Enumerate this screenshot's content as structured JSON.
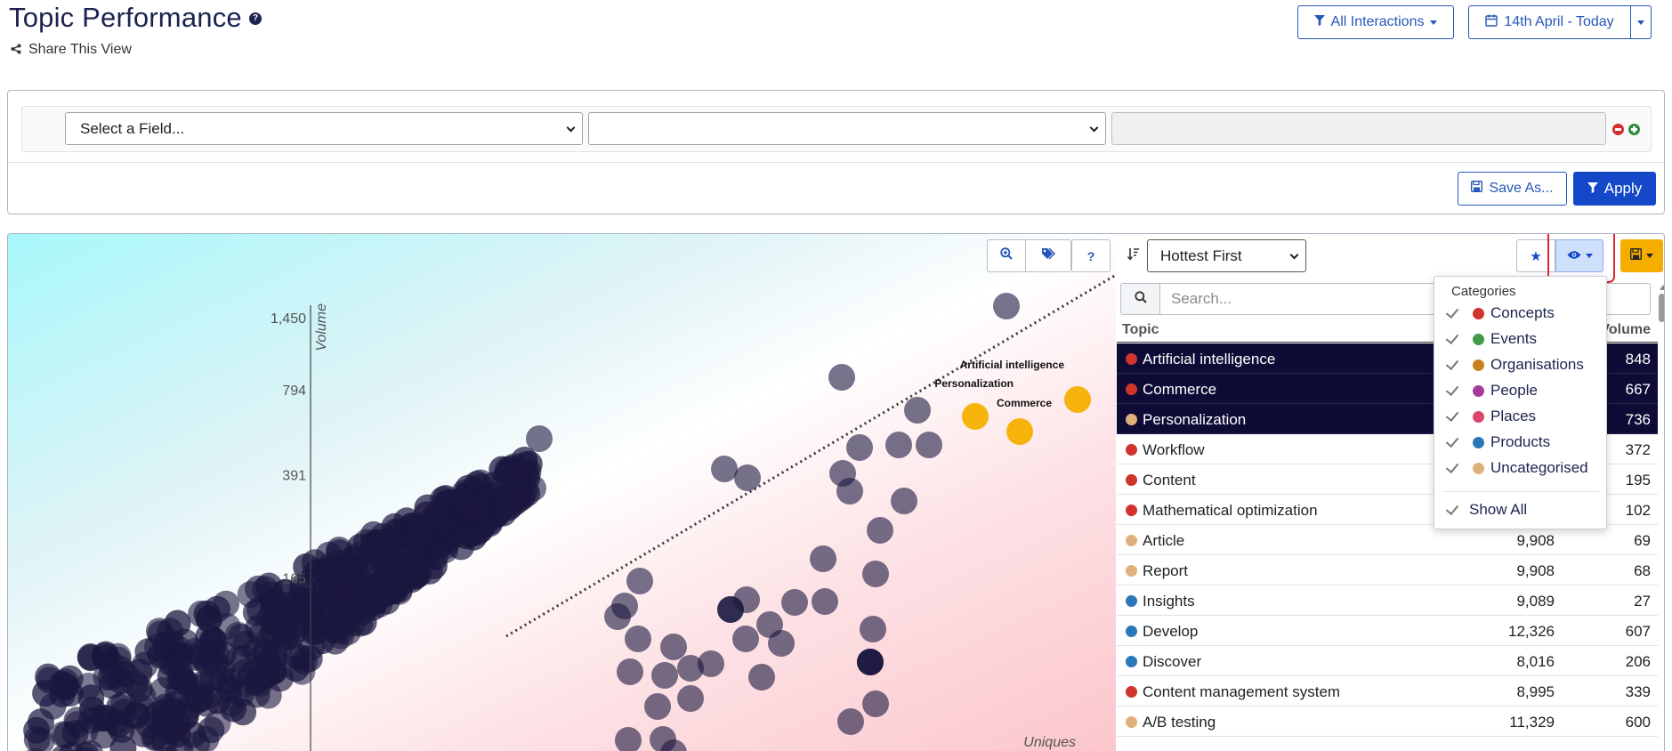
{
  "header": {
    "title": "Topic Performance",
    "help_glyph": "?",
    "share_label": "Share This View",
    "interactions_label": "All Interactions",
    "date_label": "14th April - Today"
  },
  "filter": {
    "field_placeholder": "Select a Field...",
    "operator_value": "",
    "value_text": "",
    "save_as_label": "Save As...",
    "apply_label": "Apply"
  },
  "toolbar": {
    "help_glyph": "?"
  },
  "sort": {
    "selected": "Hottest First"
  },
  "search": {
    "placeholder": "Search..."
  },
  "table": {
    "col_topic": "Topic",
    "col_volume": "Volume",
    "rows": [
      {
        "topic": "Artificial intelligence",
        "uniques": "",
        "volume": "848",
        "category": "Concepts",
        "selected": true
      },
      {
        "topic": "Commerce",
        "uniques": "",
        "volume": "667",
        "category": "Concepts",
        "selected": true
      },
      {
        "topic": "Personalization",
        "uniques": "",
        "volume": "736",
        "category": "Uncategorised",
        "selected": true
      },
      {
        "topic": "Workflow",
        "uniques": "",
        "volume": "372",
        "category": "Concepts",
        "selected": false
      },
      {
        "topic": "Content",
        "uniques": "",
        "volume": "195",
        "category": "Concepts",
        "selected": false
      },
      {
        "topic": "Mathematical optimization",
        "uniques": "",
        "volume": "102",
        "category": "Concepts",
        "selected": false
      },
      {
        "topic": "Article",
        "uniques": "9,908",
        "volume": "69",
        "category": "Uncategorised",
        "selected": false
      },
      {
        "topic": "Report",
        "uniques": "9,908",
        "volume": "68",
        "category": "Uncategorised",
        "selected": false
      },
      {
        "topic": "Insights",
        "uniques": "9,089",
        "volume": "27",
        "category": "Products",
        "selected": false
      },
      {
        "topic": "Develop",
        "uniques": "12,326",
        "volume": "607",
        "category": "Products",
        "selected": false
      },
      {
        "topic": "Discover",
        "uniques": "8,016",
        "volume": "206",
        "category": "Products",
        "selected": false
      },
      {
        "topic": "Content management system",
        "uniques": "8,995",
        "volume": "339",
        "category": "Concepts",
        "selected": false
      },
      {
        "topic": "A/B testing",
        "uniques": "11,329",
        "volume": "600",
        "category": "Uncategorised",
        "selected": false
      }
    ]
  },
  "categories_menu": {
    "header": "Categories",
    "items": [
      {
        "label": "Concepts",
        "color": "#d0342c",
        "checked": true
      },
      {
        "label": "Events",
        "color": "#3f9a4a",
        "checked": true
      },
      {
        "label": "Organisations",
        "color": "#c7831b",
        "checked": true
      },
      {
        "label": "People",
        "color": "#a63a9a",
        "checked": true
      },
      {
        "label": "Places",
        "color": "#d9476d",
        "checked": true
      },
      {
        "label": "Products",
        "color": "#2a78b8",
        "checked": true
      },
      {
        "label": "Uncategorised",
        "color": "#e0b07a",
        "checked": true
      }
    ],
    "show_all_label": "Show All"
  },
  "colors": {
    "accent": "#1448c9",
    "selected_row": "#0e0c36",
    "highlight_point": "#f5b000",
    "bubble": "#1a173f",
    "export_button": "#f5ad00",
    "annotation_ring": "#e0262f"
  },
  "chart_data": {
    "type": "scatter",
    "xlabel": "Uniques",
    "ylabel": "Volume",
    "y_scale": "log",
    "y_ticks": [
      165,
      391,
      794,
      1450
    ],
    "labeled_points": [
      {
        "name": "Artificial intelligence",
        "volume": 848,
        "highlighted": true
      },
      {
        "name": "Personalization",
        "volume": 736,
        "highlighted": true
      },
      {
        "name": "Commerce",
        "volume": 667,
        "highlighted": true
      }
    ],
    "trend_line": "dotted"
  }
}
